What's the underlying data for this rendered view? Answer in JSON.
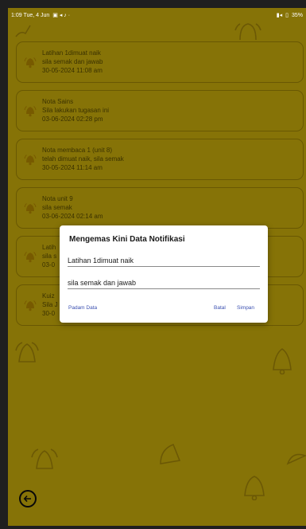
{
  "status_bar": {
    "time_date": "1:09 Tue, 4 Jun",
    "battery": "35%"
  },
  "notifications": [
    {
      "title": "Latihan 1dimuat naik",
      "body": "sila semak dan jawab",
      "timestamp": "30-05-2024 11:08 am"
    },
    {
      "title": "Nota Sains",
      "body": "Sila lakukan tugasan ini",
      "timestamp": "03-06-2024 02:28 pm"
    },
    {
      "title": "Nota membaca 1 (unit 8)",
      "body": "telah dimuat naik, sila semak",
      "timestamp": "30-05-2024 11:14 am"
    },
    {
      "title": "Nota unit 9",
      "body": "sila semak",
      "timestamp": "03-06-2024 02:14 am"
    },
    {
      "title": "Latih",
      "body": "sila s",
      "timestamp": "03-0"
    },
    {
      "title": "Kuiz",
      "body": "Sila J",
      "timestamp": "30-0"
    }
  ],
  "dialog": {
    "title": "Mengemas Kini Data Notifikasi",
    "title_field_value": "Latihan 1dimuat naik",
    "body_field_value": "sila semak dan jawab",
    "delete_label": "Padam Data",
    "cancel_label": "Batal",
    "save_label": "Simpan"
  },
  "colors": {
    "background": "#f4d20d",
    "dialog_action": "#3a4fb0",
    "bell_icon": "#d9a400"
  }
}
